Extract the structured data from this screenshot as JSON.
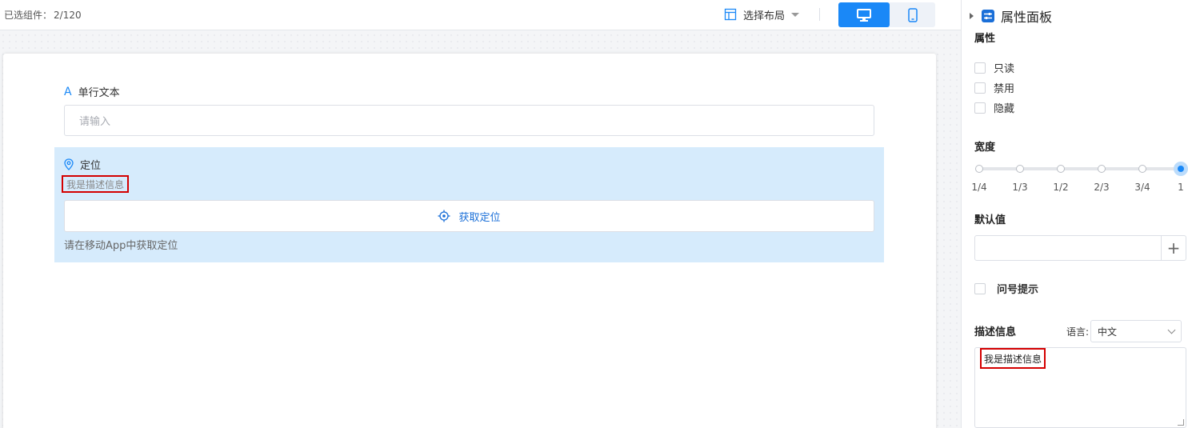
{
  "topbar": {
    "selected_label": "已选组件：",
    "selected_count": "2/120",
    "layout_label": "选择布局"
  },
  "form": {
    "text_field": {
      "label": "单行文本",
      "icon": "letter-a-icon",
      "placeholder": "请输入"
    },
    "location_field": {
      "label": "定位",
      "icon": "map-pin-icon",
      "description": "我是描述信息",
      "button_label": "获取定位",
      "button_icon": "crosshair-icon",
      "hint": "请在移动App中获取定位"
    }
  },
  "panel": {
    "title": "属性面板",
    "attributes": {
      "title": "属性",
      "options": [
        {
          "label": "只读",
          "checked": false
        },
        {
          "label": "禁用",
          "checked": false
        },
        {
          "label": "隐藏",
          "checked": false
        }
      ]
    },
    "width": {
      "title": "宽度",
      "ticks": [
        "1/4",
        "1/3",
        "1/2",
        "2/3",
        "3/4",
        "1"
      ],
      "selected": "1"
    },
    "default_value": {
      "title": "默认值",
      "value": ""
    },
    "tooltip": {
      "label": "问号提示",
      "checked": false
    },
    "description": {
      "title": "描述信息",
      "language_label": "语言:",
      "language_value": "中文",
      "value": "我是描述信息"
    }
  },
  "colors": {
    "accent": "#1a88f7",
    "highlight_border": "#d40000",
    "selected_block": "#d6ebfc"
  }
}
